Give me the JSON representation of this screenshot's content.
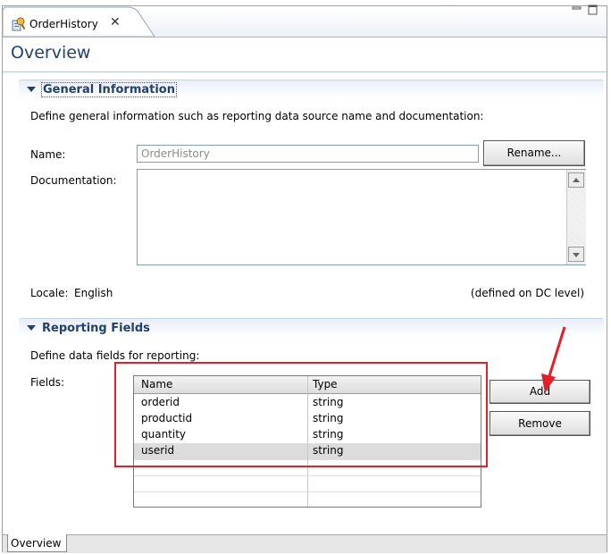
{
  "editor_tab": {
    "label": "OrderHistory",
    "close_glyph": "✕"
  },
  "overview": {
    "title": "Overview"
  },
  "general_info": {
    "section_title": "General Information",
    "description": "Define general information such as reporting data source name and documentation:",
    "name_label": "Name:",
    "name_placeholder": "OrderHistory",
    "rename_button": "Rename...",
    "documentation_label": "Documentation:",
    "locale_label": "Locale:",
    "locale_value": "English",
    "locale_note": "(defined on DC level)"
  },
  "reporting_fields": {
    "section_title": "Reporting Fields",
    "description": "Define data fields for reporting:",
    "fields_label": "Fields:",
    "columns": [
      "Name",
      "Type"
    ],
    "rows": [
      {
        "name": "orderid",
        "type": "string"
      },
      {
        "name": "productid",
        "type": "string"
      },
      {
        "name": "quantity",
        "type": "string"
      },
      {
        "name": "userid",
        "type": "string"
      }
    ],
    "selected_row": 3,
    "add_button": "Add",
    "remove_button": "Remove"
  },
  "bottom_tabs": {
    "overview": "Overview"
  },
  "annotation": {
    "color": "#e0202a"
  },
  "colors": {
    "title": "#22416e",
    "border": "#7f9db9"
  }
}
